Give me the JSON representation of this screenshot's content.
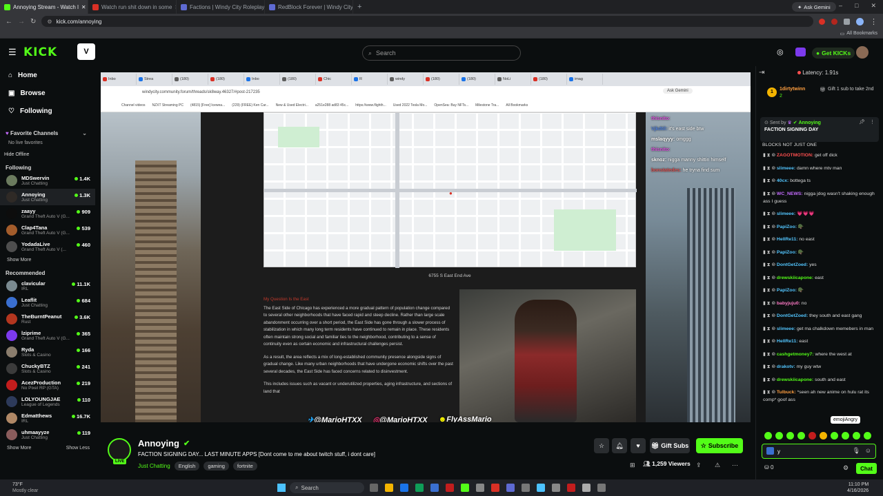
{
  "browser": {
    "tabs": [
      {
        "label": "Annoying Stream - Watch l",
        "active": true
      },
      {
        "label": "Watch run shit down in some",
        "active": false
      },
      {
        "label": "Factions | Windy City Roleplay",
        "active": false
      },
      {
        "label": "RedBlock Forever | Windy City",
        "active": false
      }
    ],
    "url": "kick.com/annoying",
    "ask_gemini": "Ask Gemini",
    "all_bookmarks": "All Bookmarks"
  },
  "header": {
    "logo": "KICK",
    "search_placeholder": "Search",
    "get_kicks": "Get KICKs"
  },
  "sidebar": {
    "nav": [
      {
        "label": "Home",
        "icon": "home-icon"
      },
      {
        "label": "Browse",
        "icon": "browse-icon"
      },
      {
        "label": "Following",
        "icon": "heart-icon"
      }
    ],
    "favorites_title": "Favorite Channels",
    "no_favorites": "No live favorites",
    "hide_offline": "Hide Offline",
    "following_title": "Following",
    "following": [
      {
        "name": "MDSwervin",
        "category": "Just Chatting",
        "viewers": "1.4K",
        "color": "#6b7b5e"
      },
      {
        "name": "Annoying",
        "category": "Just Chatting",
        "viewers": "1.3K",
        "color": "#2f2a26"
      },
      {
        "name": "zaayy",
        "category": "Grand Theft Auto V (G...",
        "viewers": "909",
        "color": "#0d0d0d"
      },
      {
        "name": "Clap4Tana",
        "category": "Grand Theft Auto V (G...",
        "viewers": "539",
        "color": "#a35c2b"
      },
      {
        "name": "YodadaLive",
        "category": "Grand Theft Auto V (...",
        "viewers": "460",
        "color": "#4e4e4e"
      }
    ],
    "show_more_1": "Show More",
    "recommended_title": "Recommended",
    "recommended": [
      {
        "name": "clavicular",
        "category": "IRL",
        "viewers": "11.1K",
        "color": "#7a8a90"
      },
      {
        "name": "Leaflit",
        "category": "Just Chatting",
        "viewers": "684",
        "color": "#3a6fd0"
      },
      {
        "name": "TheBurntPeanut",
        "category": "Rust",
        "viewers": "3.6K",
        "color": "#b3361f"
      },
      {
        "name": "lziprime",
        "category": "Grand Theft Auto V (G...",
        "viewers": "365",
        "color": "#7c3aed"
      },
      {
        "name": "Ryda",
        "category": "Slots & Casino",
        "viewers": "166",
        "color": "#8a7d6d"
      },
      {
        "name": "ChuckyBTZ",
        "category": "Slots & Casino",
        "viewers": "241",
        "color": "#3b3b3b"
      },
      {
        "name": "AcezProduction",
        "category": "No Pixel RP (GTA)",
        "viewers": "219",
        "color": "#c21d1d"
      },
      {
        "name": "LOLYOUNGJAE",
        "category": "League of Legends",
        "viewers": "110",
        "color": "#2d3a5a"
      },
      {
        "name": "Edmatthews",
        "category": "IRL",
        "viewers": "16.7K",
        "color": "#b08866"
      },
      {
        "name": "uhmaayyze",
        "category": "Just Chatting",
        "viewers": "119",
        "color": "#8a5c5c"
      }
    ],
    "show_more_2": "Show More",
    "show_less": "Show Less"
  },
  "video": {
    "inner_url": "windycity.community.forum/threads/sk8way.46327/#post-217235",
    "inner_ask_gemini": "Ask Gemini",
    "inner_tabs": [
      "Inbo",
      "Strea",
      "(180)",
      "(180)",
      "Inbo",
      "(180)",
      "Chic",
      "R",
      "windy",
      "(180)",
      "(180)",
      "NoLi",
      "(180)",
      "imag"
    ],
    "bookmarks": [
      "Channel videos",
      "NZXT Streaming PC",
      "(4815) [Free] Icewea...",
      "(229) (FREE) Ken Car...",
      "New & Used Electri...",
      "a251e288 ad83 45c...",
      "https://www.flighth...",
      "Used 2022 Tesla Mo...",
      "OpenSea: Buy NFTs...",
      "Milestone Tra...",
      "All Bookmarks"
    ],
    "address": "6755 S East End Ave",
    "para_heading": "My Question Is the East",
    "paragraphs": [
      "The East Side of Chicago has experienced a more gradual pattern of population change compared to several other neighborhoods that have faced rapid and steep decline. Rather than large scale abandonment occurring over a short period, the East Side has gone through a slower process of stabilization in which many long term residents have continued to remain in place. These residents often maintain strong social and familiar ties to the neighborhood, contributing to a sense of continuity even as certain economic and infrastructural challenges persist.",
      "As a result, the area reflects a mix of long-established community presence alongside signs of gradual change. Like many urban neighborhoods that have undergone economic shifts over the past several decades, the East Side has faced concerns related to disinvestment.",
      "This includes issues such as vacant or underutilized properties, aging infrastructure, and sections of land that"
    ],
    "overlay_chat": [
      {
        "user": "thisnito:",
        "msg": "",
        "color": "#d94fd9"
      },
      {
        "user": "Vjkdtil:",
        "msg": "it's east side btw",
        "color": "#4f7fd9"
      },
      {
        "user": "mslaqyyy:",
        "msg": "omggg",
        "color": "#fff"
      },
      {
        "user": "thisnito:",
        "msg": "",
        "color": "#d94fd9"
      },
      {
        "user": "sknoz:",
        "msg": "nigga manny shittin himself",
        "color": "#fff"
      },
      {
        "user": "bonstatedes:",
        "msg": "he tryna find sum",
        "color": "#d94f4f"
      }
    ],
    "socials": [
      "@MarioHTXX",
      "@MarioHTXX",
      "FlyAssMario"
    ]
  },
  "stream": {
    "name": "Annoying",
    "live": "LIVE",
    "title": "FACTION SIGNING DAY... LAST MINUTE APPS  [Dont come to me about twitch stuff, i dont care]",
    "category": "Just Chatting",
    "tags": [
      "English",
      "gaming",
      "fortnite"
    ],
    "gift_subs": "Gift Subs",
    "subscribe": "Subscribe",
    "viewers": "1,259 Viewers"
  },
  "chat": {
    "latency": "Latency: 1.91s",
    "gifter": "1dirtytwinn",
    "gifter_count": "2",
    "gift_prompt": "Gift 1 sub to take 2nd",
    "pinned_sent_by": "Sent by",
    "pinned_user": "Annoying",
    "pinned_text": "FACTION SIGNING DAY",
    "pinned_tail": "BLOCKS NOT JUST ONE",
    "messages": [
      {
        "user": "ZAGOTMOTION:",
        "msg": "get off dick",
        "color": "#ff4f4f"
      },
      {
        "user": "slimeee:",
        "msg": "damn where mtv man",
        "color": "#53c6ff"
      },
      {
        "user": "40cx:",
        "msg": "bottega ts",
        "color": "#53c6ff"
      },
      {
        "user": "WC_NEWS:",
        "msg": "nigga jdog wasn't shaking enough ass I guess",
        "color": "#c56bff"
      },
      {
        "user": "slimeee:",
        "msg": "💗💗💗",
        "color": "#53c6ff"
      },
      {
        "user": "PapiZoo:",
        "msg": "🪖",
        "color": "#53c6ff"
      },
      {
        "user": "HellRe11:",
        "msg": "no east",
        "color": "#53c6ff"
      },
      {
        "user": "PapiZoo:",
        "msg": "🪖",
        "color": "#53c6ff"
      },
      {
        "user": "DontGetZoed:",
        "msg": "yes",
        "color": "#53c6ff"
      },
      {
        "user": "drewskiicapone:",
        "msg": "east",
        "color": "#53fc18"
      },
      {
        "user": "PapiZoo:",
        "msg": "🪖",
        "color": "#53c6ff"
      },
      {
        "user": "babyjuju0:",
        "msg": "no",
        "color": "#ff79c6"
      },
      {
        "user": "DontGetZoed:",
        "msg": "they south and east gang",
        "color": "#53c6ff"
      },
      {
        "user": "slimeee:",
        "msg": "get ma chalkdown memebers in man",
        "color": "#53c6ff"
      },
      {
        "user": "HellRe11:",
        "msg": "east",
        "color": "#53c6ff"
      },
      {
        "user": "cashgetmoney7:",
        "msg": "where the west at",
        "color": "#53fc18"
      },
      {
        "user": "drakotv:",
        "msg": "my guy wtw",
        "color": "#53c6ff"
      },
      {
        "user": "drewskiicapone:",
        "msg": "south and east",
        "color": "#53fc18"
      },
      {
        "user": "Tulbuck:",
        "msg": "*seen ah new anime on hulu rat its comp* goof ass",
        "color": "#ff9f40"
      }
    ],
    "tooltip": "emojiAngry",
    "input_value": "y",
    "points": "0",
    "chat_button": "Chat"
  },
  "taskbar": {
    "weather_temp": "73°F",
    "weather_desc": "Mostly clear",
    "search": "Search",
    "time": "11:10 PM",
    "date": "4/16/2026"
  }
}
